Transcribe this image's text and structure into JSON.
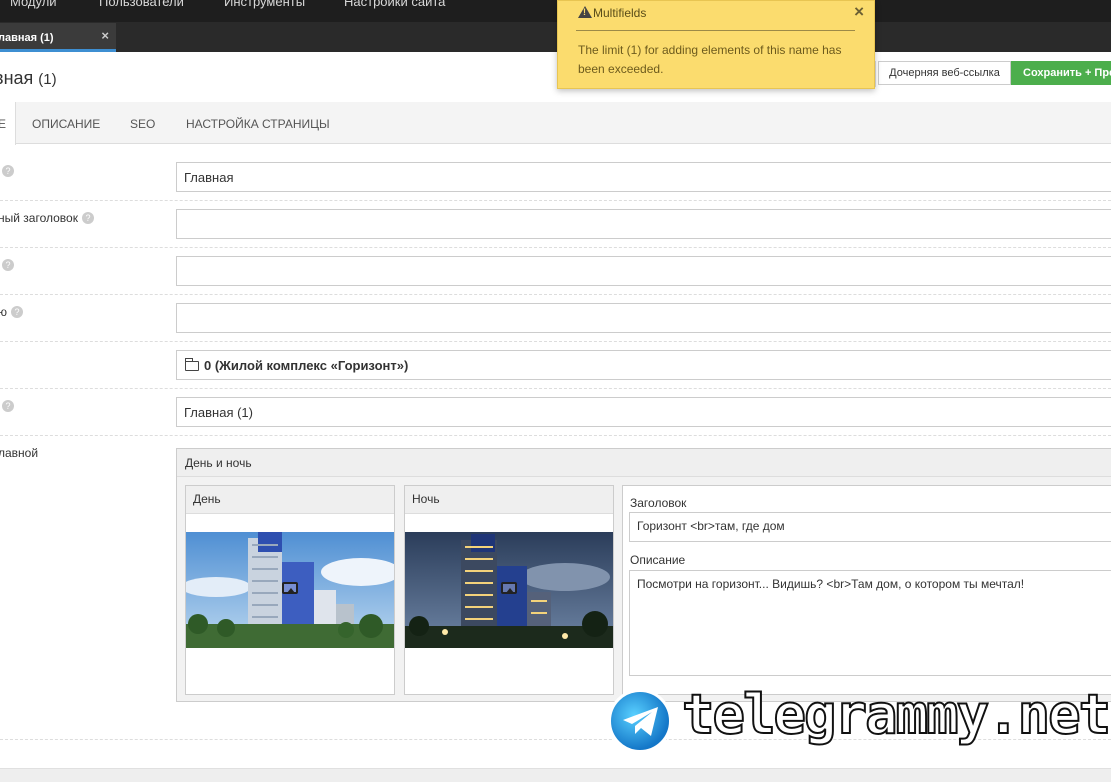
{
  "nav": {
    "items": [
      "Модули",
      "Пользователи",
      "Инструменты",
      "Настройки сайта"
    ]
  },
  "tabs": {
    "active_label": "лавная (1)",
    "close_glyph": "×"
  },
  "page": {
    "title": "вная",
    "count": "(1)"
  },
  "toolbar": {
    "child_weblink_label": "Дочерняя веб-ссылка",
    "save_label": "Сохранить + Прод"
  },
  "form_tabs": {
    "active": "Е",
    "items": [
      "ОПИСАНИЕ",
      "SEO",
      "НАСТРОЙКА СТРАНИЦЫ"
    ]
  },
  "fields": {
    "title": {
      "label": "",
      "value": "Главная"
    },
    "long_title": {
      "label": "ный заголовок",
      "value": ""
    },
    "field3": {
      "label": "",
      "value": ""
    },
    "field4": {
      "label": "ю",
      "value": ""
    },
    "parent": {
      "label": "",
      "value": "0 (Жилой комплекс «Горизонт»)"
    },
    "menu_title": {
      "label": "",
      "value": "Главная (1)"
    },
    "multi": {
      "label": "лавной"
    }
  },
  "multifield": {
    "title": "День и ночь",
    "day_label": "День",
    "night_label": "Ночь",
    "heading_label": "Заголовок",
    "heading_value": "Горизонт <br>там, где дом",
    "desc_label": "Описание",
    "desc_value": "Посмотри на горизонт... Видишь? <br>Там дом, о котором ты мечтал!"
  },
  "notice": {
    "title": "Multifields",
    "message": "The limit (1) for adding elements of this name has been exceeded.",
    "close_glyph": "×"
  },
  "help_glyph": "?",
  "watermark": {
    "text": "telegrammy.net"
  },
  "colors": {
    "accent": "#3e8fd2",
    "save": "#4cae4c",
    "notice_bg": "#fbdc6e"
  }
}
